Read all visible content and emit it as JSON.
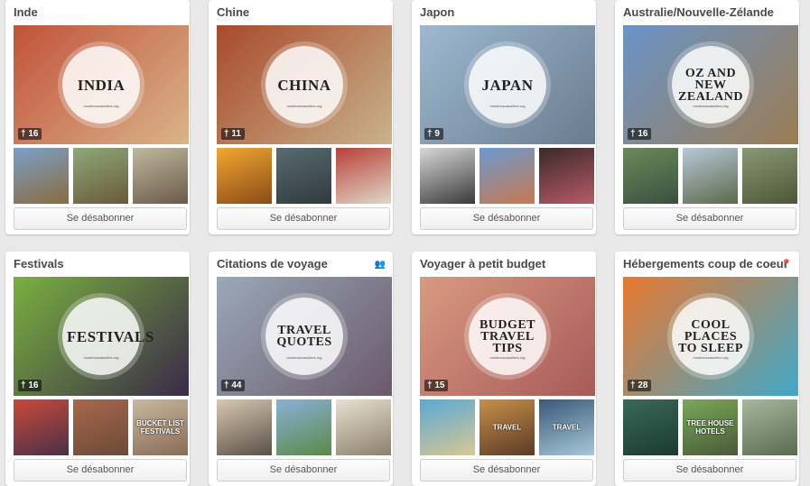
{
  "boards": [
    {
      "title": "Inde",
      "pins": "16",
      "cover_text": "INDIA",
      "cover_site": "mostmoscasuliers.org",
      "button": "Se désabonner",
      "flag_icon": "",
      "colors": [
        "#c2523a",
        "#d9b48a"
      ],
      "thumbs": [
        {
          "colors": [
            "#7aa0c8",
            "#8a6b3e"
          ],
          "text": ""
        },
        {
          "colors": [
            "#8fa878",
            "#6a5a3a"
          ],
          "text": ""
        },
        {
          "colors": [
            "#c0b8a0",
            "#6b5a48"
          ],
          "text": ""
        }
      ]
    },
    {
      "title": "Chine",
      "pins": "11",
      "cover_text": "CHINA",
      "cover_site": "mostmoscasuliers.org",
      "button": "Se désabonner",
      "flag_icon": "",
      "colors": [
        "#a84a2c",
        "#c9b28c"
      ],
      "thumbs": [
        {
          "colors": [
            "#f2a830",
            "#8a4a18"
          ],
          "text": ""
        },
        {
          "colors": [
            "#5a6a70",
            "#2e3a3e"
          ],
          "text": ""
        },
        {
          "colors": [
            "#b84038",
            "#e0d8c8"
          ],
          "text": ""
        }
      ]
    },
    {
      "title": "Japon",
      "pins": "9",
      "cover_text": "JAPAN",
      "cover_site": "mostmoscasuliers.org",
      "button": "Se désabonner",
      "flag_icon": "",
      "colors": [
        "#9db8d0",
        "#6a7c8e"
      ],
      "thumbs": [
        {
          "colors": [
            "#d8d8d8",
            "#3a3a3a"
          ],
          "text": ""
        },
        {
          "colors": [
            "#6a9ad0",
            "#c87850"
          ],
          "text": ""
        },
        {
          "colors": [
            "#3a2a28",
            "#b85a68"
          ],
          "text": ""
        }
      ]
    },
    {
      "title": "Australie/Nouvelle-Zélande",
      "pins": "16",
      "cover_text": "OZ AND\nNEW\nZEALAND",
      "cover_site": "mostmoscasuliers.org",
      "button": "Se désabonner",
      "flag_icon": "",
      "colors": [
        "#6a94c8",
        "#9c7c52"
      ],
      "thumbs": [
        {
          "colors": [
            "#6a8a5a",
            "#3a5040"
          ],
          "text": ""
        },
        {
          "colors": [
            "#b8c8d8",
            "#5a6a48"
          ],
          "text": ""
        },
        {
          "colors": [
            "#8a9878",
            "#4a5838"
          ],
          "text": ""
        }
      ]
    },
    {
      "title": "Festivals",
      "pins": "16",
      "cover_text": "FESTIVALS",
      "cover_site": "mostmoscasuliers.org",
      "button": "Se désabonner",
      "flag_icon": "",
      "colors": [
        "#7ab040",
        "#3a2a48"
      ],
      "thumbs": [
        {
          "colors": [
            "#c84a3a",
            "#4a3048"
          ],
          "text": ""
        },
        {
          "colors": [
            "#a8684a",
            "#6a4a3a"
          ],
          "text": ""
        },
        {
          "colors": [
            "#c8b8a0",
            "#8a6a58"
          ],
          "text": "BUCKET LIST FESTIVALS"
        }
      ]
    },
    {
      "title": "Citations de voyage",
      "pins": "44",
      "cover_text": "TRAVEL\nQUOTES",
      "cover_site": "mostmoscasuliers.org",
      "button": "Se désabonner",
      "flag_icon": "👥",
      "colors": [
        "#9aa8b8",
        "#6a5a6a"
      ],
      "thumbs": [
        {
          "colors": [
            "#d8c8b0",
            "#5a5048"
          ],
          "text": ""
        },
        {
          "colors": [
            "#8ab0d8",
            "#5a8a48"
          ],
          "text": ""
        },
        {
          "colors": [
            "#e8e0d0",
            "#8a8070"
          ],
          "text": ""
        }
      ]
    },
    {
      "title": "Voyager à petit budget",
      "pins": "15",
      "cover_text": "BUDGET\nTRAVEL\nTIPS",
      "cover_site": "mostmoscasuliers.org",
      "button": "Se désabonner",
      "flag_icon": "",
      "colors": [
        "#d89a80",
        "#a85a5a"
      ],
      "thumbs": [
        {
          "colors": [
            "#5aa8d8",
            "#d8c890"
          ],
          "text": ""
        },
        {
          "colors": [
            "#c89048",
            "#5a3a28"
          ],
          "text": "TRAVEL"
        },
        {
          "colors": [
            "#3a5878",
            "#a8c8d8"
          ],
          "text": "TRAVEL"
        }
      ]
    },
    {
      "title": "Hébergements coup de coeur",
      "pins": "28",
      "cover_text": "COOL\nPLACES\nTO SLEEP",
      "cover_site": "mostmoscasuliers.org",
      "button": "Se désabonner",
      "flag_icon": "📍",
      "colors": [
        "#e87830",
        "#40a8c8"
      ],
      "thumbs": [
        {
          "colors": [
            "#3a6a58",
            "#1a3a30"
          ],
          "text": ""
        },
        {
          "colors": [
            "#7aa858",
            "#4a5a38"
          ],
          "text": "TREE HOUSE HOTELS"
        },
        {
          "colors": [
            "#a8b8a0",
            "#5a6a50"
          ],
          "text": ""
        }
      ]
    }
  ]
}
